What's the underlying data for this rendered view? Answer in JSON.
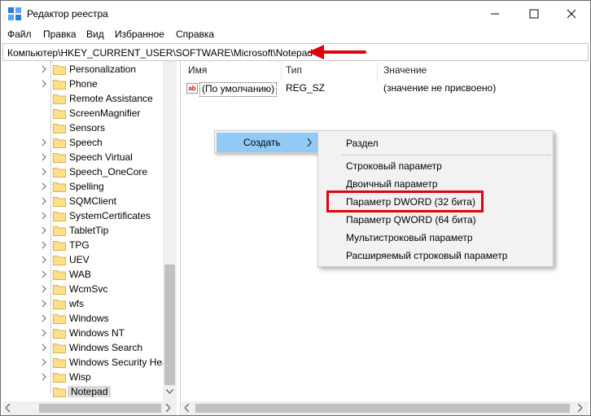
{
  "window": {
    "title": "Редактор реестра",
    "accent_color": "#e3000f"
  },
  "menu": [
    "Файл",
    "Правка",
    "Вид",
    "Избранное",
    "Справка"
  ],
  "address": "Компьютер\\HKEY_CURRENT_USER\\SOFTWARE\\Microsoft\\Notepad",
  "tree": {
    "items": [
      {
        "label": "Personalization",
        "expandable": true
      },
      {
        "label": "Phone",
        "expandable": true
      },
      {
        "label": "Remote Assistance",
        "expandable": false
      },
      {
        "label": "ScreenMagnifier",
        "expandable": false
      },
      {
        "label": "Sensors",
        "expandable": false
      },
      {
        "label": "Speech",
        "expandable": true
      },
      {
        "label": "Speech Virtual",
        "expandable": true
      },
      {
        "label": "Speech_OneCore",
        "expandable": true
      },
      {
        "label": "Spelling",
        "expandable": true
      },
      {
        "label": "SQMClient",
        "expandable": true
      },
      {
        "label": "SystemCertificates",
        "expandable": true
      },
      {
        "label": "TabletTip",
        "expandable": true
      },
      {
        "label": "TPG",
        "expandable": true
      },
      {
        "label": "UEV",
        "expandable": true
      },
      {
        "label": "WAB",
        "expandable": true
      },
      {
        "label": "WcmSvc",
        "expandable": true
      },
      {
        "label": "wfs",
        "expandable": true
      },
      {
        "label": "Windows",
        "expandable": true
      },
      {
        "label": "Windows NT",
        "expandable": true
      },
      {
        "label": "Windows Search",
        "expandable": true
      },
      {
        "label": "Windows Security Hea",
        "expandable": true
      },
      {
        "label": "Wisp",
        "expandable": true
      },
      {
        "label": "Notepad",
        "expandable": false,
        "selected": true
      }
    ]
  },
  "list": {
    "columns": [
      "Имя",
      "Тип",
      "Значение"
    ],
    "rows": [
      {
        "name": "(По умолчанию)",
        "type": "REG_SZ",
        "value": "(значение не присвоено)"
      }
    ]
  },
  "context_menu": {
    "create_label": "Создать",
    "submenu": {
      "section": "Раздел",
      "items": [
        "Строковый параметр",
        "Двоичный параметр",
        "Параметр DWORD (32 бита)",
        "Параметр QWORD (64 бита)",
        "Мультистроковый параметр",
        "Расширяемый строковый параметр"
      ],
      "highlighted_index": 2
    }
  }
}
